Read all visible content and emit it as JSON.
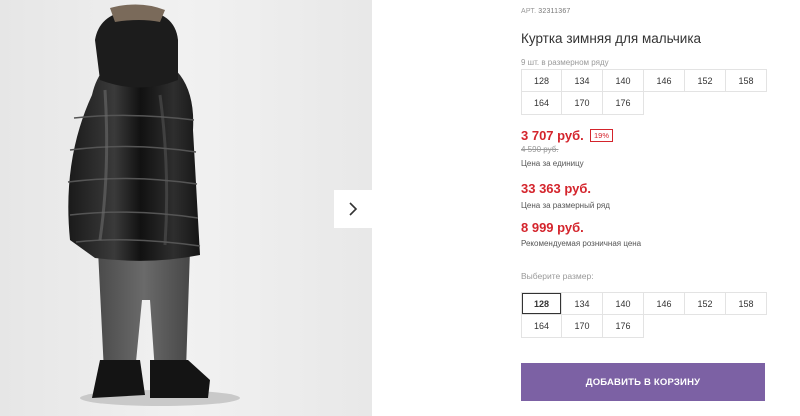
{
  "product": {
    "article_label": "АРТ.",
    "article_number": "32311367",
    "title": "Куртка зимняя для мальчика",
    "row_note": "9 шт. в размерном ряду"
  },
  "size_row_grid": {
    "sizes": [
      "128",
      "134",
      "140",
      "146",
      "152",
      "158",
      "164",
      "170",
      "176"
    ]
  },
  "prices": {
    "unit_price": "3 707 руб.",
    "discount_badge": "19%",
    "old_price": "4 590 руб.",
    "unit_note": "Цена за единицу",
    "row_price": "33 363 руб.",
    "row_price_note": "Цена за размерный ряд",
    "rrp_price": "8 999 руб.",
    "rrp_note": "Рекомендуемая розничная цена"
  },
  "size_picker": {
    "label": "Выберите размер:",
    "sizes": [
      "128",
      "134",
      "140",
      "146",
      "152",
      "158",
      "164",
      "170",
      "176"
    ],
    "selected": "128"
  },
  "actions": {
    "add_to_cart": "ДОБАВИТЬ В КОРЗИНУ"
  },
  "icons": {
    "next": "chevron-right-icon"
  },
  "colors": {
    "price_red": "#d4242c",
    "cart_purple": "#7c61a4"
  }
}
